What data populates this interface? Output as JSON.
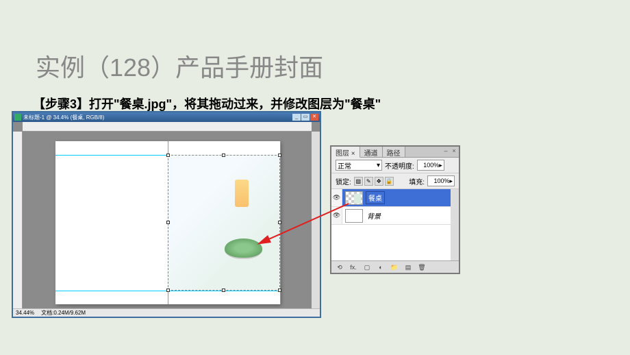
{
  "slide": {
    "title": "实例（128）产品手册封面",
    "step_text": "【步骤3】打开\"餐桌.jpg\"，将其拖动过来，并修改图层为\"餐桌\""
  },
  "ps_window": {
    "title": "未标题-1 @ 34.4% (餐桌, RGB/8)",
    "status_zoom": "34.44%",
    "status_doc": "文档:0.24M/9.62M"
  },
  "layers_panel": {
    "tabs": {
      "layers": "图层",
      "channels": "通道",
      "paths": "路径"
    },
    "blend_mode": "正常",
    "opacity_label": "不透明度:",
    "opacity_value": "100%",
    "lock_label": "锁定:",
    "fill_label": "填充:",
    "fill_value": "100%",
    "layers": [
      {
        "name": "餐桌",
        "selected": true,
        "locked": false
      },
      {
        "name": "背景",
        "selected": false,
        "locked": true
      }
    ]
  }
}
